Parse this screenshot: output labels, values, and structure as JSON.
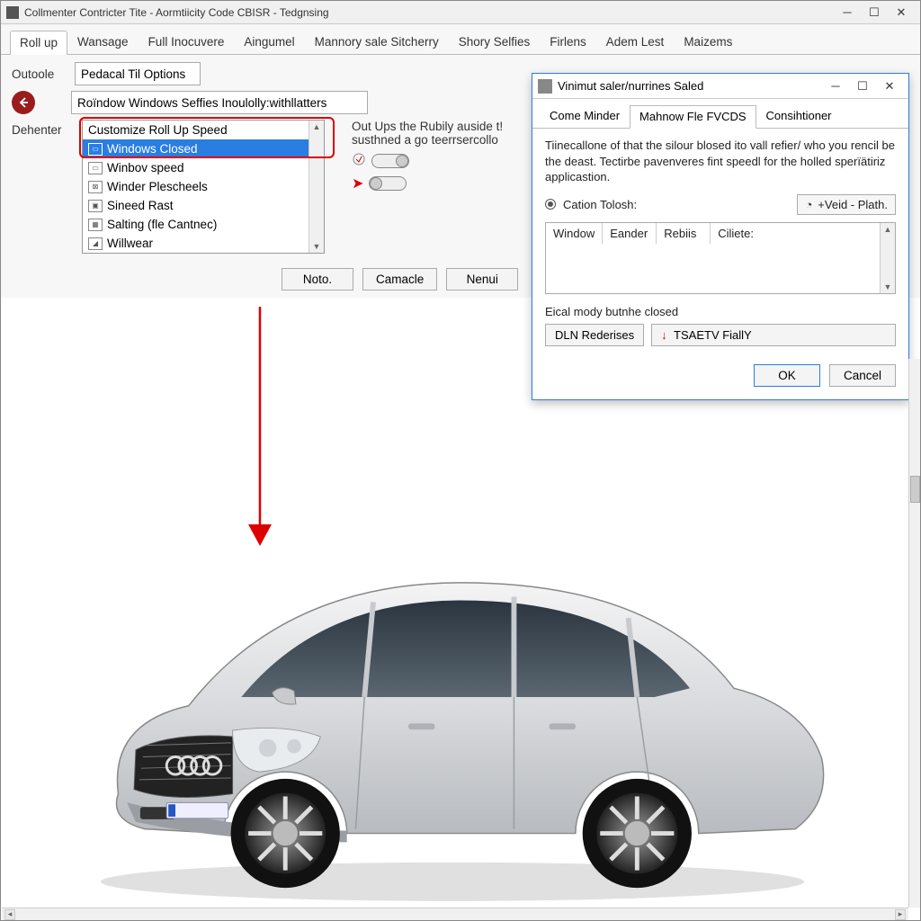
{
  "main": {
    "title": "Collmenter Contricter Tite - Aormtiicity Code  CBISR - Tedgnsing",
    "tabs": [
      "Roll up",
      "Wansage",
      "Full Inocuvere",
      "Aingumel",
      "Mannory sale Sitcherry",
      "Shory Selfies",
      "Firlens",
      "Adem Lest",
      "Maizems"
    ],
    "active_tab": 0,
    "outoole_label": "Outoole",
    "outoole_value": "Pedacal Til Options",
    "sub_value": "Roïndow Windows Seffies Inoulolly:withllatters",
    "dehenter_label": "Dehenter",
    "list": {
      "header": "Customize Roll Up Speed",
      "selected": "Windows Closed",
      "items": [
        "Winbov speed",
        "Winder Plescheels",
        "Sineed Rast",
        "Salting (fle Cantnec)",
        "Willwear"
      ]
    },
    "aside_text": "Out Ups the Rubily auside t! susthned a go teerrsercollo",
    "btn_noto": "Noto.",
    "btn_camacle": "Camacle",
    "btn_nenui": "Nenui"
  },
  "dialog": {
    "title": "Vinimut saler/nurrines Saled",
    "tabs": [
      "Come Minder",
      "Mahnow Fle FVCDS",
      "Consihtioner"
    ],
    "active_tab": 1,
    "body_text": "Tiinecallone of that the silour blosed ito vall refier/ who you rencil be the deast. Tectirbe pavenveres fint speedl for the holled sperïätiriz applicastion.",
    "radio_label": "Cation Tolosh:",
    "pill_value": "+Veid - Plath.",
    "table_headers": [
      "Window",
      "Eander",
      "Rebiis",
      "Ciliete:"
    ],
    "section_label": "Eical mody butnhe closed",
    "btn_dln": "DLN Rederises",
    "btn_tsa": "TSAETV FiallY",
    "btn_ok": "OK",
    "btn_cancel": "Cancel"
  }
}
